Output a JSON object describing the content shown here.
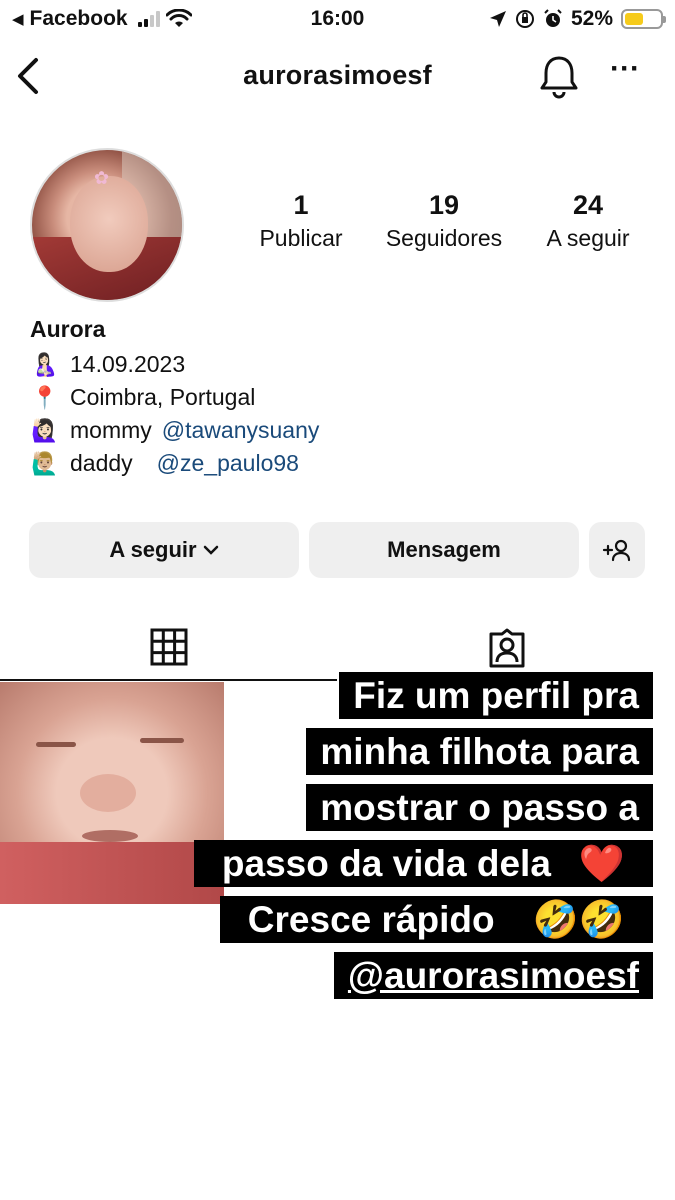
{
  "status_bar": {
    "back_app": "Facebook",
    "time": "16:00",
    "battery": "52%",
    "battery_level": 0.52
  },
  "header": {
    "username": "aurorasimoesf"
  },
  "profile": {
    "stats": [
      {
        "num": "1",
        "label": "Publicar"
      },
      {
        "num": "19",
        "label": "Seguidores"
      },
      {
        "num": "24",
        "label": "A seguir"
      }
    ],
    "name": "Aurora",
    "bio": {
      "birth_emoji": "🤱🏻",
      "birth_date": "14.09.2023",
      "location_emoji": "📍",
      "location": "Coimbra, Portugal",
      "mommy_emoji": "🙋🏻‍♀️",
      "mommy_label": "mommy",
      "mommy_handle": "@tawanysuany",
      "daddy_emoji": "🙋🏼‍♂️",
      "daddy_label": "daddy",
      "daddy_handle": "@ze_paulo98"
    }
  },
  "actions": {
    "follow": "A seguir",
    "message": "Mensagem"
  },
  "story": {
    "lines": [
      "Fiz um perfil pra",
      "minha filhota  para",
      "mostrar o passo a",
      "passo da vida dela"
    ],
    "heart": "❤️",
    "line5": "Cresce rápido",
    "laugh": "🤣🤣",
    "mention": "@aurorasimoesf"
  }
}
